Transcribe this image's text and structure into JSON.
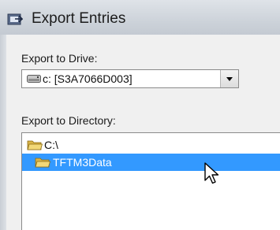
{
  "window": {
    "title": "Export Entries"
  },
  "drive": {
    "label": "Export to Drive:",
    "selected": "c: [S3A7066D003]"
  },
  "directory": {
    "label": "Export to Directory:",
    "items": [
      {
        "name": "C:\\",
        "selected": false,
        "open": true
      },
      {
        "name": "TFTM3Data",
        "selected": true,
        "open": true
      }
    ]
  },
  "colors": {
    "selection": "#3399ff",
    "folder": "#e8c55a"
  },
  "icons": [
    "app-icon",
    "drive-icon",
    "dropdown-arrow-icon",
    "folder-open-icon",
    "mouse-pointer-icon"
  ]
}
